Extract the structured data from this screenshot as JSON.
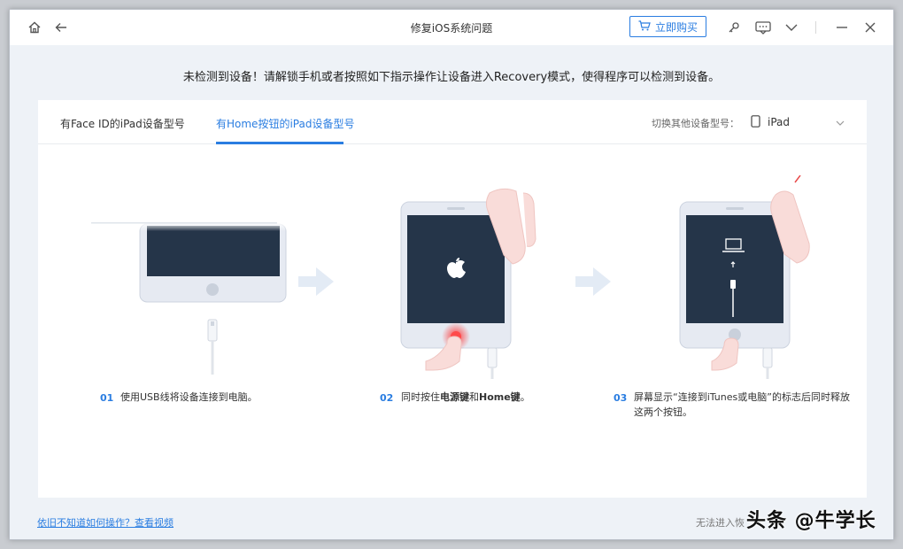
{
  "window": {
    "title": "修复iOS系统问题"
  },
  "toolbar": {
    "buy_label": "立即购买"
  },
  "instruction": "未检测到设备！请解锁手机或者按照如下指示操作让设备进入Recovery模式，使得程序可以检测到设备。",
  "tabs": [
    {
      "label": "有Face ID的iPad设备型号"
    },
    {
      "label": "有Home按钮的iPad设备型号"
    }
  ],
  "device_switch": {
    "label": "切换其他设备型号：",
    "selected": "iPad"
  },
  "steps": [
    {
      "num": "01",
      "text": "使用USB线将设备连接到电脑。"
    },
    {
      "num": "02",
      "text_pre": "同时按住",
      "text_b1": "电源键",
      "text_mid": "和",
      "text_b2": "Home键",
      "text_post": "。"
    },
    {
      "num": "03",
      "text_line1": "屏幕显示“连接到iTunes或电脑”的标志后同时释放",
      "text_line2": "这两个按钮。"
    }
  ],
  "footer": {
    "help_link": "依旧不知道如何操作？查看视频",
    "right_text": "无法进入恢"
  },
  "watermark": "头条 @牛学长",
  "colors": {
    "accent": "#2a7de1",
    "screen": "#253549",
    "device": "#e6eaf2"
  }
}
